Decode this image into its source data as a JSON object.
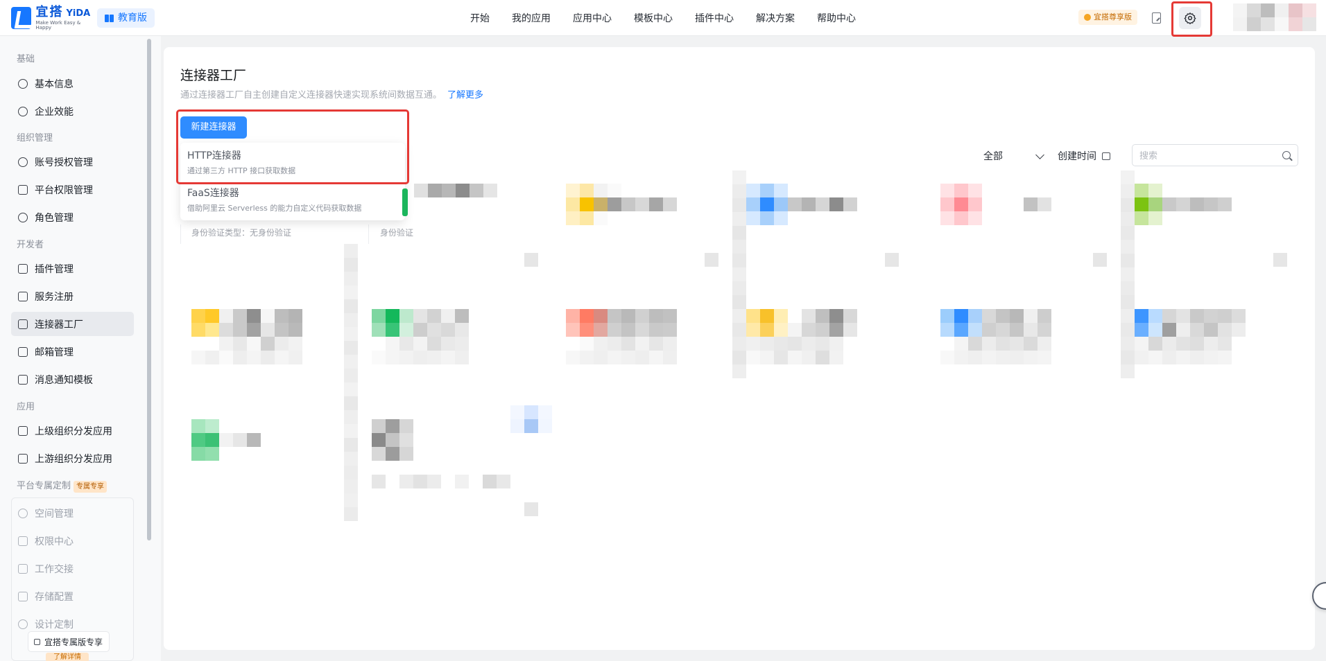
{
  "header": {
    "logo_cn": "宜搭",
    "logo_en": "YiDA",
    "logo_slogan": "Make Work Easy & Happy",
    "edition_badge": "教育版",
    "nav": [
      "开始",
      "我的应用",
      "应用中心",
      "模板中心",
      "插件中心",
      "解决方案",
      "帮助中心"
    ],
    "pro_badge": "宜搭尊享版"
  },
  "sidebar": {
    "sections": {
      "basic": "基础",
      "org": "组织管理",
      "developer": "开发者",
      "apps": "应用",
      "exclusive": "平台专属定制"
    },
    "exclusive_tag": "专属专享",
    "items": {
      "basic_info": "基本信息",
      "efficiency": "企业效能",
      "account_auth": "账号授权管理",
      "platform_perm": "平台权限管理",
      "role_mgmt": "角色管理",
      "plugin_mgmt": "插件管理",
      "service_reg": "服务注册",
      "connector_factory": "连接器工厂",
      "mail_mgmt": "邮箱管理",
      "msg_template": "消息通知模板",
      "upper_dist": "上级组织分发应用",
      "upstream_dist": "上游组织分发应用",
      "space_mgmt": "空间管理",
      "perm_center": "权限中心",
      "handover": "工作交接",
      "storage": "存储配置",
      "design": "设计定制"
    },
    "upgrade_tip": "宜搭专属版专享",
    "learn_more": "了解详情"
  },
  "main": {
    "title": "连接器工厂",
    "description": "通过连接器工厂自主创建自定义连接器快速实现系统间数据互通。",
    "learn_more": "了解更多",
    "new_button": "新建连接器",
    "dropdown": [
      {
        "title": "HTTP连接器",
        "desc": "通过第三方 HTTP 接口获取数据"
      },
      {
        "title": "FaaS连接器",
        "desc": "借助阿里云 Serverless 的能力自定义代码获取数据"
      }
    ],
    "filter_all": "全部",
    "sort_label": "创建时间",
    "search_placeholder": "搜索",
    "card_auth_label": "身份验证类型：无身份验证",
    "card_auth_label_partial": "身份验证"
  },
  "colors": {
    "primary": "#2f8cff",
    "highlight": "#e53935",
    "active_bg": "#e8eaee"
  }
}
